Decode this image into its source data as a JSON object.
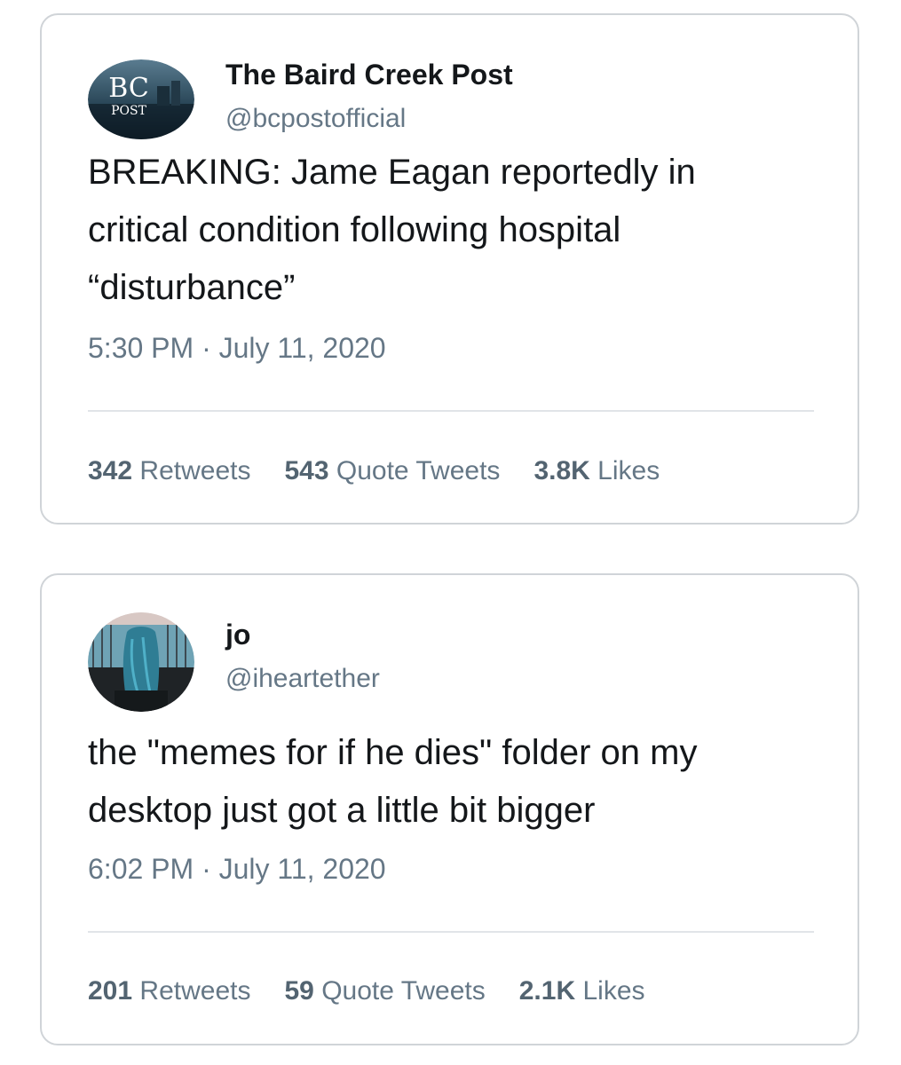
{
  "tweets": [
    {
      "display_name": "The Baird Creek Post",
      "handle": "@bcpostofficial",
      "avatar_text": {
        "line1": "BC",
        "line2": "POST"
      },
      "text_lines": [
        "BREAKING: Jame Eagan reportedly in",
        "critical condition following hospital",
        "“disturbance”"
      ],
      "timestamp": "5:30 PM · July 11, 2020",
      "retweets": {
        "count": "342",
        "label": "Retweets"
      },
      "quote_tweets": {
        "count": "543",
        "label": "Quote Tweets"
      },
      "likes": {
        "count": "3.8K",
        "label": "Likes"
      }
    },
    {
      "display_name": "jo",
      "handle": "@iheartether",
      "text_lines": [
        "the \"memes for if he dies\" folder on my",
        "desktop just got a little bit bigger"
      ],
      "timestamp": "6:02 PM · July 11, 2020",
      "retweets": {
        "count": "201",
        "label": "Retweets"
      },
      "quote_tweets": {
        "count": "59",
        "label": "Quote Tweets"
      },
      "likes": {
        "count": "2.1K",
        "label": "Likes"
      }
    }
  ],
  "colors": {
    "text_primary": "#14171a",
    "text_secondary": "#657786",
    "border": "#d0d4d8",
    "divider": "#e1e4e8"
  }
}
